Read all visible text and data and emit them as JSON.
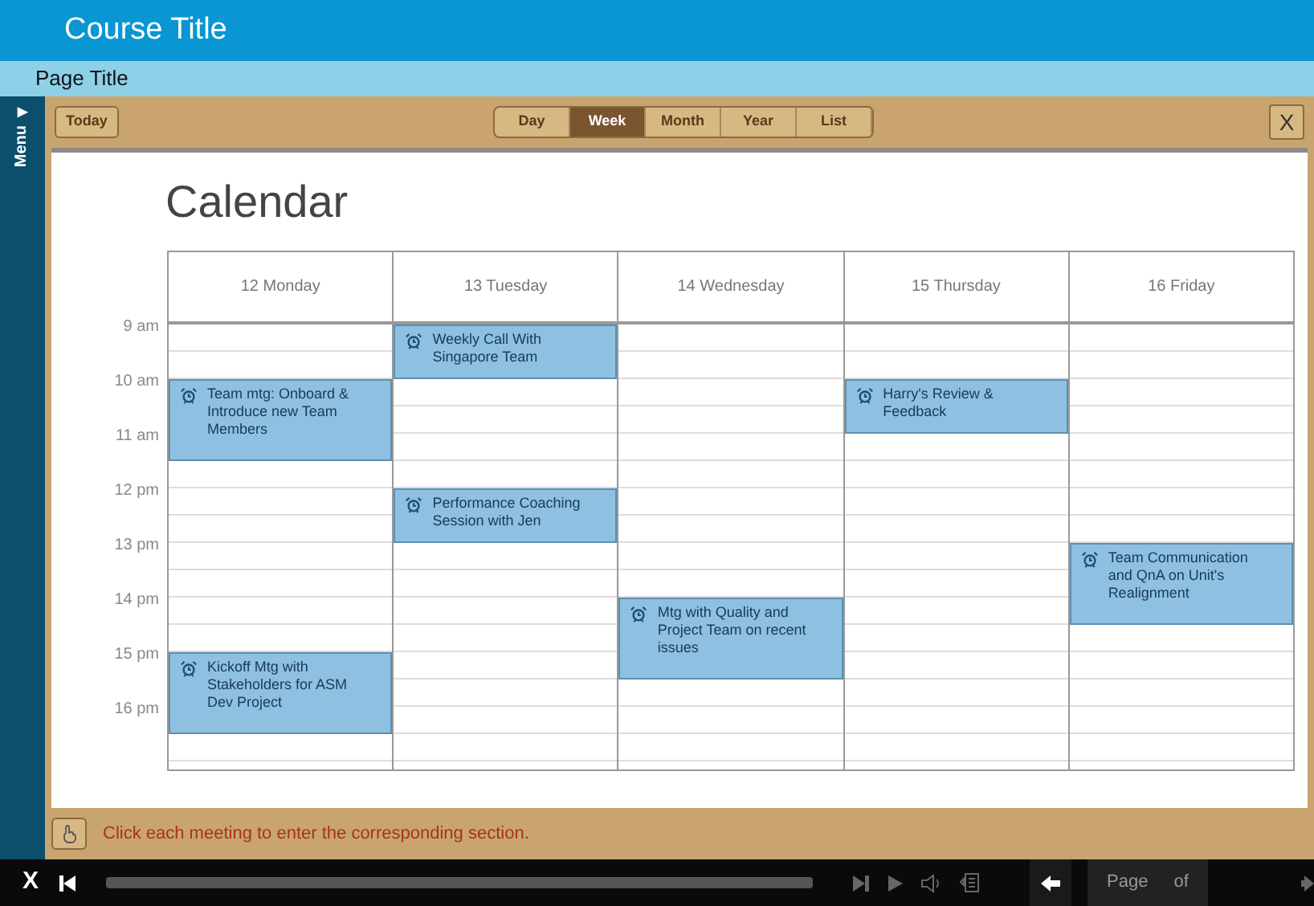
{
  "header": {
    "course_title": "Course Title",
    "page_title": "Page Title"
  },
  "menu": {
    "arrow": "▶",
    "label": "Menu"
  },
  "toolbar": {
    "today": "Today",
    "close": "X",
    "views": [
      {
        "label": "Day",
        "selected": false
      },
      {
        "label": "Week",
        "selected": true
      },
      {
        "label": "Month",
        "selected": false
      },
      {
        "label": "Year",
        "selected": false
      },
      {
        "label": "List",
        "selected": false
      }
    ]
  },
  "calendar": {
    "title": "Calendar",
    "times": [
      "9 am",
      "10 am",
      "11 am",
      "12 pm",
      "13 pm",
      "14 pm",
      "15 pm",
      "16 pm"
    ],
    "days": [
      {
        "label": "12 Monday",
        "slots": [
          {
            "kind": "free"
          },
          {
            "kind": "free"
          },
          {
            "kind": "event",
            "title": "Team mtg: Onboard & Introduce new Team Members"
          },
          {
            "kind": "cont"
          },
          {
            "kind": "cont"
          },
          {
            "kind": "free"
          },
          {
            "kind": "free"
          },
          {
            "kind": "free"
          },
          {
            "kind": "free"
          },
          {
            "kind": "free"
          },
          {
            "kind": "free"
          },
          {
            "kind": "free"
          },
          {
            "kind": "event",
            "title": "Kickoff Mtg with Stakeholders for ASM Dev Project"
          },
          {
            "kind": "cont"
          },
          {
            "kind": "cont"
          },
          {
            "kind": "free"
          }
        ]
      },
      {
        "label": "13 Tuesday",
        "slots": [
          {
            "kind": "event",
            "title": "Weekly Call With Singapore Team"
          },
          {
            "kind": "cont"
          },
          {
            "kind": "free"
          },
          {
            "kind": "free"
          },
          {
            "kind": "free"
          },
          {
            "kind": "free"
          },
          {
            "kind": "event",
            "title": "Performance Coaching Session with Jen"
          },
          {
            "kind": "cont"
          },
          {
            "kind": "free"
          },
          {
            "kind": "free"
          },
          {
            "kind": "free"
          },
          {
            "kind": "free"
          },
          {
            "kind": "free"
          },
          {
            "kind": "free"
          },
          {
            "kind": "free"
          },
          {
            "kind": "free"
          }
        ]
      },
      {
        "label": "14 Wednesday",
        "slots": [
          {
            "kind": "free"
          },
          {
            "kind": "free"
          },
          {
            "kind": "free"
          },
          {
            "kind": "free"
          },
          {
            "kind": "free"
          },
          {
            "kind": "free"
          },
          {
            "kind": "free"
          },
          {
            "kind": "free"
          },
          {
            "kind": "free"
          },
          {
            "kind": "free"
          },
          {
            "kind": "event",
            "title": "Mtg with Quality and Project Team on recent issues"
          },
          {
            "kind": "cont"
          },
          {
            "kind": "cont"
          },
          {
            "kind": "free"
          },
          {
            "kind": "free"
          },
          {
            "kind": "free"
          }
        ]
      },
      {
        "label": "15 Thursday",
        "slots": [
          {
            "kind": "free"
          },
          {
            "kind": "free"
          },
          {
            "kind": "event",
            "title": "Harry's Review & Feedback"
          },
          {
            "kind": "cont"
          },
          {
            "kind": "free"
          },
          {
            "kind": "free"
          },
          {
            "kind": "free"
          },
          {
            "kind": "free"
          },
          {
            "kind": "free"
          },
          {
            "kind": "free"
          },
          {
            "kind": "free"
          },
          {
            "kind": "free"
          },
          {
            "kind": "free"
          },
          {
            "kind": "free"
          },
          {
            "kind": "free"
          },
          {
            "kind": "free"
          }
        ]
      },
      {
        "label": "16 Friday",
        "slots": [
          {
            "kind": "free"
          },
          {
            "kind": "free"
          },
          {
            "kind": "free"
          },
          {
            "kind": "free"
          },
          {
            "kind": "free"
          },
          {
            "kind": "free"
          },
          {
            "kind": "free"
          },
          {
            "kind": "free"
          },
          {
            "kind": "event",
            "title": "Team Communication and QnA on Unit's Realignment"
          },
          {
            "kind": "cont"
          },
          {
            "kind": "cont"
          },
          {
            "kind": "free"
          },
          {
            "kind": "free"
          },
          {
            "kind": "free"
          },
          {
            "kind": "free"
          },
          {
            "kind": "free"
          }
        ]
      }
    ]
  },
  "instruction": "Click each meeting to enter the corresponding section.",
  "player": {
    "close": "X",
    "page_label": "Page",
    "of_label": "of"
  }
}
